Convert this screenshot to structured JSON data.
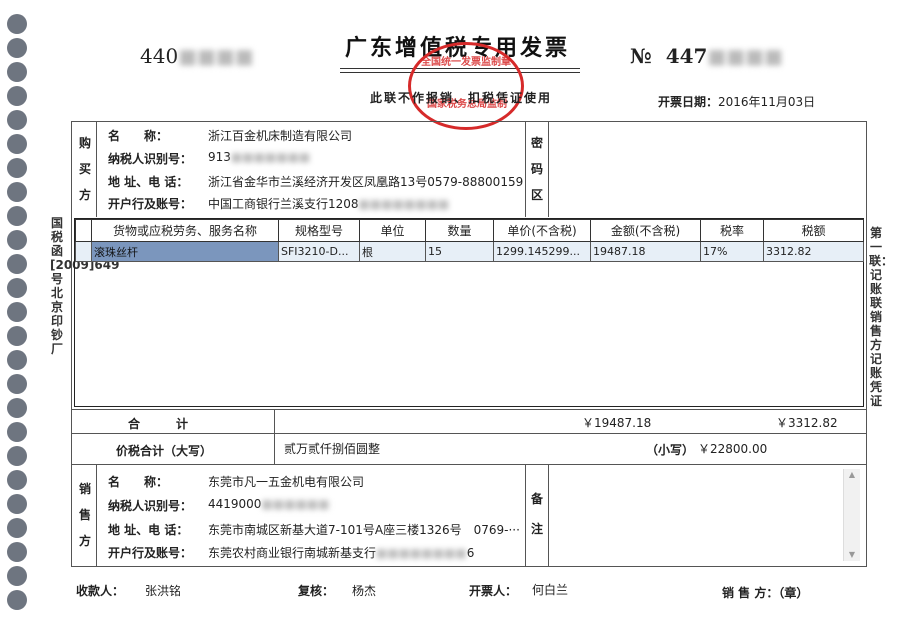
{
  "invoice": {
    "title": "广东增值税专用发票",
    "code_prefix": "440",
    "number_symbol": "№",
    "number_prefix": "447",
    "subtitle": "此联不作报销、扣税凭证使用",
    "date_label": "开票日期：",
    "date_value": "2016年11月03日",
    "seal_text_top": "全国统一发票监制章",
    "seal_text_mid": "国家税务总局监制"
  },
  "buyer": {
    "section": "购买方",
    "name_label": "名　　称：",
    "name": "浙江百金机床制造有限公司",
    "tax_label": "纳税人识别号：",
    "tax_id": "913",
    "addr_label": "地 址、电 话：",
    "addr": "浙江省金华市兰溪经济开发区凤凰路13号0579-88800159",
    "bank_label": "开户行及账号：",
    "bank": "中国工商银行兰溪支行1208"
  },
  "cipher": {
    "label": "密码区"
  },
  "items": {
    "headers": [
      "货物或应税劳务、服务名称",
      "规格型号",
      "单位",
      "数量",
      "单价(不含税)",
      "金额(不含税)",
      "税率",
      "税额"
    ],
    "rows": [
      [
        "滚珠丝杆",
        "SFI3210-D...",
        "根",
        "15",
        "1299.145299...",
        "19487.18",
        "17%",
        "3312.82"
      ]
    ]
  },
  "totals": {
    "label": "合　　　计",
    "amount": "￥19487.18",
    "tax": "￥3312.82",
    "sum_label": "价税合计（大写）",
    "sum_chinese": "贰万贰仟捌佰圆整",
    "small_label": "（小写）",
    "sum_small": "￥22800.00"
  },
  "seller": {
    "section": "销售方",
    "name_label": "名　　称：",
    "name": "东莞市凡一五金机电有限公司",
    "tax_label": "纳税人识别号：",
    "tax_id": "4419000",
    "addr_label": "地 址、电 话：",
    "addr": "东莞市南城区新基大道7-101号A座三楼1326号　0769-···",
    "bank_label": "开户行及账号：",
    "bank": "东莞农村商业银行南城新基支行",
    "bank_tail": "6"
  },
  "remark": {
    "label": "备注"
  },
  "footer": {
    "payee_label": "收款人：",
    "payee": "张洪铭",
    "reviewer_label": "复核：",
    "reviewer": "杨杰",
    "drawer_label": "开票人：",
    "drawer": "何白兰",
    "seller_label": "销 售 方：（章）"
  },
  "side_left": "国税函[2009]649号北京印钞厂",
  "side_right": "第一联：记账联 销售方记账凭证",
  "colors": {
    "seal": "#d62a2a",
    "selection": "#7b96bd",
    "row_bg": "#e7eff7",
    "hole": "#6e7580"
  }
}
